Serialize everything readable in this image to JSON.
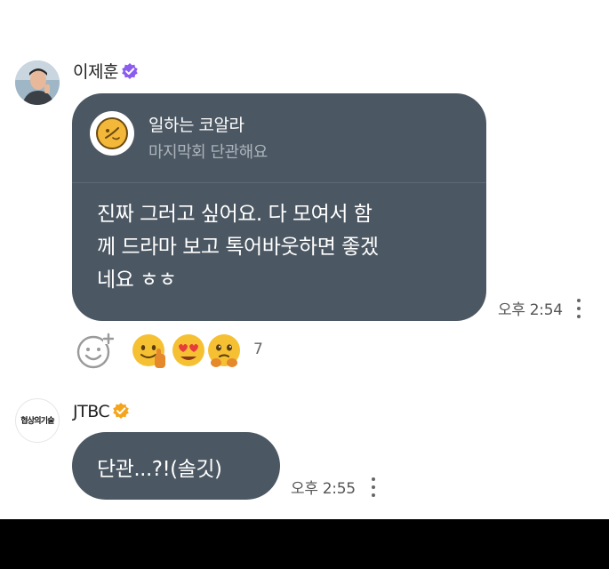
{
  "messages": {
    "m1": {
      "sender_name": "이제훈",
      "quote": {
        "author": "일하는 코알라",
        "text": "마지막회 단관해요"
      },
      "body_lines": [
        "진짜 그러고 싶어요. 다 모여서 함",
        "께 드라마 보고 톡어바웃하면 좋겠",
        "네요 ㅎㅎ"
      ],
      "time": "오후 2:54",
      "reaction_count": "7"
    },
    "m2": {
      "sender_name": "JTBC",
      "avatar_text": "협상의기술",
      "body": "단관...?!(솔깃)",
      "time": "오후 2:55"
    }
  },
  "colors": {
    "bubble": "#4b5762",
    "verified_m1": "#8a5cf0",
    "verified_m2": "#f4a51c"
  },
  "icons": [
    "verified-badge-icon",
    "add-reaction-icon",
    "more-options-icon",
    "koala-icon"
  ]
}
